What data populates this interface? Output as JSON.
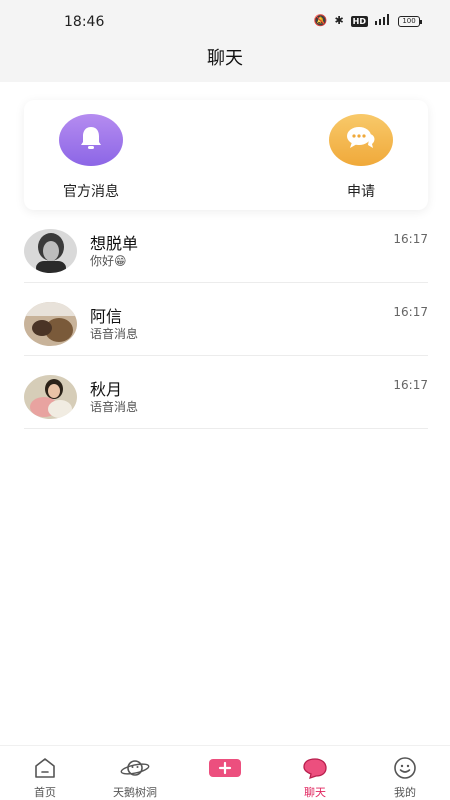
{
  "status_bar": {
    "time": "18:46",
    "battery": "100"
  },
  "header": {
    "title": "聊天"
  },
  "top_entries": {
    "official": {
      "label": "官方消息",
      "icon": "bell-icon",
      "color": "#9a74ea"
    },
    "apply": {
      "label": "申请",
      "icon": "chat-bubble-icon",
      "color": "#f2b14b"
    }
  },
  "chats": [
    {
      "name": "想脱单",
      "preview": "你好😁",
      "time": "16:17"
    },
    {
      "name": "阿信",
      "preview": "语音消息",
      "time": "16:17"
    },
    {
      "name": "秋月",
      "preview": "语音消息",
      "time": "16:17"
    }
  ],
  "nav": {
    "items": [
      {
        "label": "首页",
        "icon": "home-icon"
      },
      {
        "label": "天鹅树洞",
        "icon": "planet-icon"
      },
      {
        "label": "",
        "icon": "plus-icon"
      },
      {
        "label": "聊天",
        "icon": "chat-icon",
        "active": true
      },
      {
        "label": "我的",
        "icon": "smiley-icon"
      }
    ],
    "active_color": "#e0245e"
  }
}
